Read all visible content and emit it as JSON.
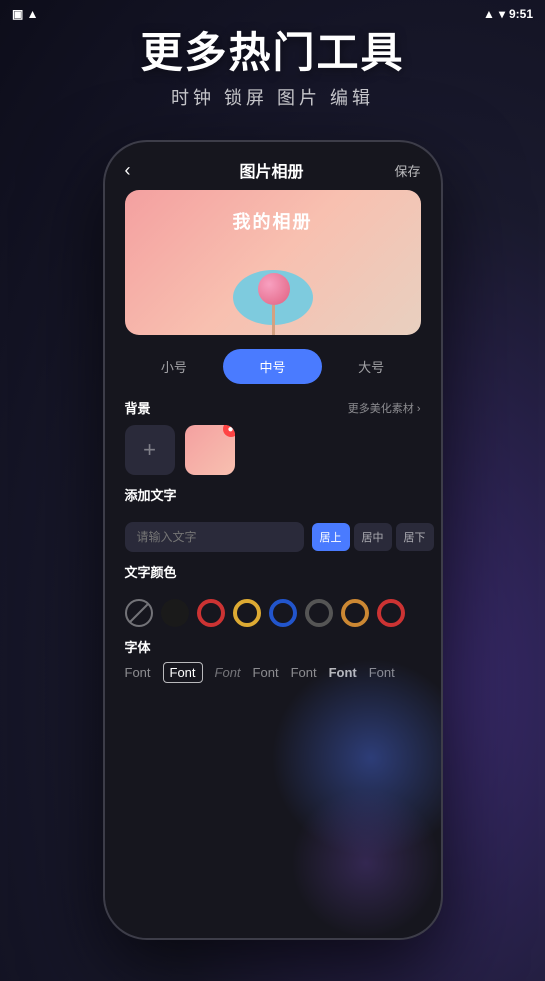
{
  "statusBar": {
    "time": "9:51",
    "icons": [
      "signal",
      "wifi",
      "battery"
    ]
  },
  "header": {
    "mainTitle": "更多热门工具",
    "subTitle": "时钟 锁屏 图片 编辑"
  },
  "phone": {
    "topBar": {
      "back": "‹",
      "title": "图片相册",
      "save": "保存"
    },
    "preview": {
      "albumTitle": "我的相册"
    },
    "sizeSelector": {
      "options": [
        "小号",
        "中号",
        "大号"
      ],
      "active": 1
    },
    "background": {
      "label": "背景",
      "moreLink": "更多美化素材 ›"
    },
    "addText": {
      "label": "添加文字",
      "placeholder": "请输入文字",
      "alignButtons": [
        "居上",
        "居中",
        "居下"
      ],
      "activeAlign": 0
    },
    "textColor": {
      "label": "文字颜色",
      "colors": [
        {
          "type": "none",
          "value": ""
        },
        {
          "type": "solid",
          "value": "#1a1a1a"
        },
        {
          "type": "ring",
          "value": "#cc3333",
          "border": "#cc3333"
        },
        {
          "type": "ring",
          "value": "#ddaa33",
          "border": "#ddaa33"
        },
        {
          "type": "ring",
          "value": "#2255cc",
          "border": "#2255cc"
        },
        {
          "type": "ring",
          "value": "#333333",
          "border": "#333333"
        },
        {
          "type": "ring",
          "value": "#cc8833",
          "border": "#cc8833"
        },
        {
          "type": "ring",
          "value": "#cc3333",
          "border": "#cc3333"
        }
      ]
    },
    "font": {
      "label": "字体",
      "fonts": [
        {
          "text": "Font",
          "style": "normal",
          "active": false
        },
        {
          "text": "Font",
          "style": "normal",
          "active": true
        },
        {
          "text": "Font",
          "style": "italic",
          "active": false
        },
        {
          "text": "Font",
          "style": "normal",
          "active": false
        },
        {
          "text": "Font",
          "style": "normal",
          "active": false
        },
        {
          "text": "Font",
          "style": "bold",
          "active": false
        },
        {
          "text": "Font",
          "style": "partial",
          "active": false
        }
      ]
    }
  }
}
